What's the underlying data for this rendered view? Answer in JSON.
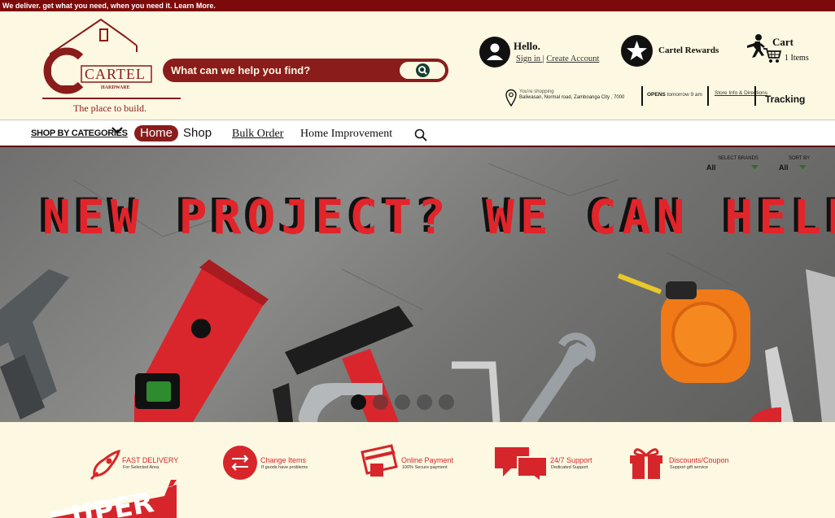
{
  "announcement": {
    "text": "We deliver. get what you need, when you need it. ",
    "link": "Learn More."
  },
  "brand": {
    "name": "CARTEL",
    "sub": "HARDWARE",
    "tagline": "The place to build."
  },
  "search": {
    "placeholder": "What can we help you find?"
  },
  "account": {
    "greeting": "Hello.",
    "sign_in": "Sign in |",
    "create": "Create Account"
  },
  "rewards": {
    "label": "Cartel Rewards"
  },
  "cart": {
    "label": "Cart",
    "count": "1 Items"
  },
  "store": {
    "shopping_label": "You're shopping",
    "address": "Baliwasan, Normal road, Zamboanga City , 7000",
    "opens_label": "OPENS",
    "opens_time": " tomorrow 9 am",
    "info_link": "Store Info & Directions",
    "tracking": "Tracking"
  },
  "nav": {
    "categories": "SHOP BY CATEGORIES",
    "home": "Home",
    "shop": "Shop",
    "bulk": "Bulk Order",
    "improvement": "Home Improvement"
  },
  "hero": {
    "title": "NEW PROJECT? WE CAN HELP.",
    "select_brands_label": "SELECT BRANDS",
    "select_brands_value": "All",
    "sort_label": "SORT BY",
    "sort_value": "All",
    "slide_count": 5,
    "active_slide": 1
  },
  "features": [
    {
      "title": "FAST DELIVERY",
      "sub": "For Selected Area",
      "icon": "rocket-icon"
    },
    {
      "title": "Change Items",
      "sub": "If goods have problems",
      "icon": "exchange-icon"
    },
    {
      "title": "Online Payment",
      "sub": "100% Secure payment",
      "icon": "card-payment-icon"
    },
    {
      "title": "24/7 Support",
      "sub": "Dedicated Support",
      "icon": "chat-bubbles-icon"
    },
    {
      "title": "Discounts/Coupon",
      "sub": "Support gift service",
      "icon": "gift-icon"
    }
  ],
  "promo": {
    "text": "UPER"
  },
  "colors": {
    "brand_red": "#8a1c1c",
    "accent_red": "#d6262b",
    "background": "#fdf8e1"
  }
}
